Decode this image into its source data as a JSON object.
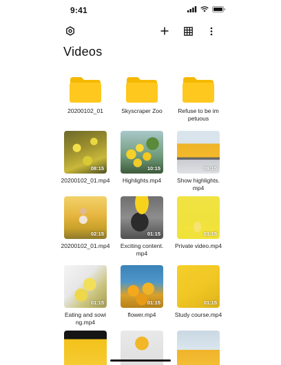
{
  "status_bar": {
    "time": "9:41"
  },
  "page": {
    "title": "Videos"
  },
  "folders": [
    {
      "name": "20200102_01"
    },
    {
      "name": "Skyscraper Zoo"
    },
    {
      "name": "Refuse to be impetuous"
    }
  ],
  "videos": [
    {
      "name": "20200102_01.mp4",
      "duration": "08:15"
    },
    {
      "name": "Highlights.mp4",
      "duration": "10:15"
    },
    {
      "name": "Show highlights.mp4",
      "duration": "09:15"
    },
    {
      "name": "20200102_01.mp4",
      "duration": "02:15"
    },
    {
      "name": "Exciting content.mp4",
      "duration": "01:15"
    },
    {
      "name": "Private video.mp4",
      "duration": "01:15"
    },
    {
      "name": "Eating and sowing.mp4",
      "duration": "01:15"
    },
    {
      "name": "flower.mp4",
      "duration": "01:15"
    },
    {
      "name": "Study course.mp4",
      "duration": "01:15"
    }
  ],
  "colors": {
    "accent": "#FFC81E",
    "folder": "#FFC81E",
    "folder_tab": "#F5B800"
  },
  "icons": [
    "settings-icon",
    "add-icon",
    "grid-view-icon",
    "more-icon",
    "folder-icon",
    "signal-icon",
    "wifi-icon",
    "battery-icon"
  ]
}
